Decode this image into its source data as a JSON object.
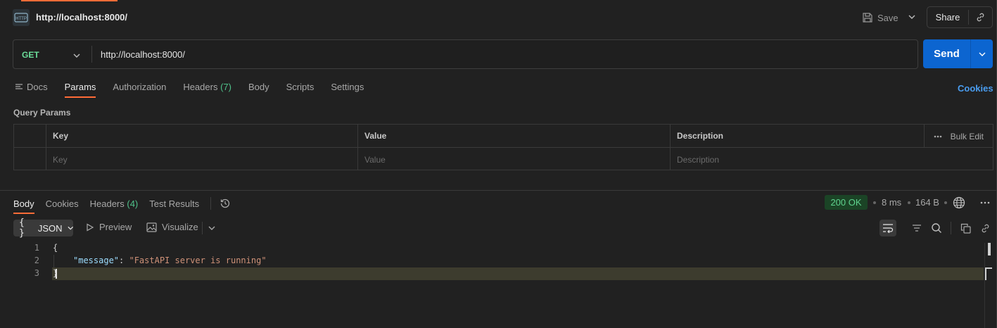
{
  "header": {
    "icon": "http-request-icon",
    "title": "http://localhost:8000/",
    "save_label": "Save",
    "share_label": "Share"
  },
  "request": {
    "method": "GET",
    "url": "http://localhost:8000/",
    "send_label": "Send"
  },
  "request_tabs": [
    {
      "label": "Docs",
      "count": ""
    },
    {
      "label": "Params",
      "count": "",
      "active": true
    },
    {
      "label": "Authorization",
      "count": ""
    },
    {
      "label": "Headers",
      "count": "(7)"
    },
    {
      "label": "Body",
      "count": ""
    },
    {
      "label": "Scripts",
      "count": ""
    },
    {
      "label": "Settings",
      "count": ""
    }
  ],
  "cookies_link": "Cookies",
  "query_params": {
    "title": "Query Params",
    "columns": [
      "Key",
      "Value",
      "Description"
    ],
    "bulk_edit": "Bulk Edit",
    "placeholders": {
      "key": "Key",
      "value": "Value",
      "description": "Description"
    }
  },
  "response": {
    "tabs": [
      {
        "label": "Body",
        "count": "",
        "active": true
      },
      {
        "label": "Cookies",
        "count": ""
      },
      {
        "label": "Headers",
        "count": "(4)"
      },
      {
        "label": "Test Results",
        "count": ""
      }
    ],
    "status": "200 OK",
    "time": "8 ms",
    "size": "164 B",
    "format": "JSON",
    "preview_label": "Preview",
    "visualize_label": "Visualize",
    "body_lines": [
      {
        "num": "1",
        "text": "{"
      },
      {
        "num": "2",
        "key": "\"message\"",
        "sep": ": ",
        "value": "\"FastAPI server is running\""
      },
      {
        "num": "3",
        "text": "}"
      }
    ]
  },
  "colors": {
    "accent": "#ff6c37",
    "send": "#0c65d0",
    "method_get": "#6bdd9a",
    "status_ok": "#5fd38e",
    "link": "#4a9df0"
  }
}
